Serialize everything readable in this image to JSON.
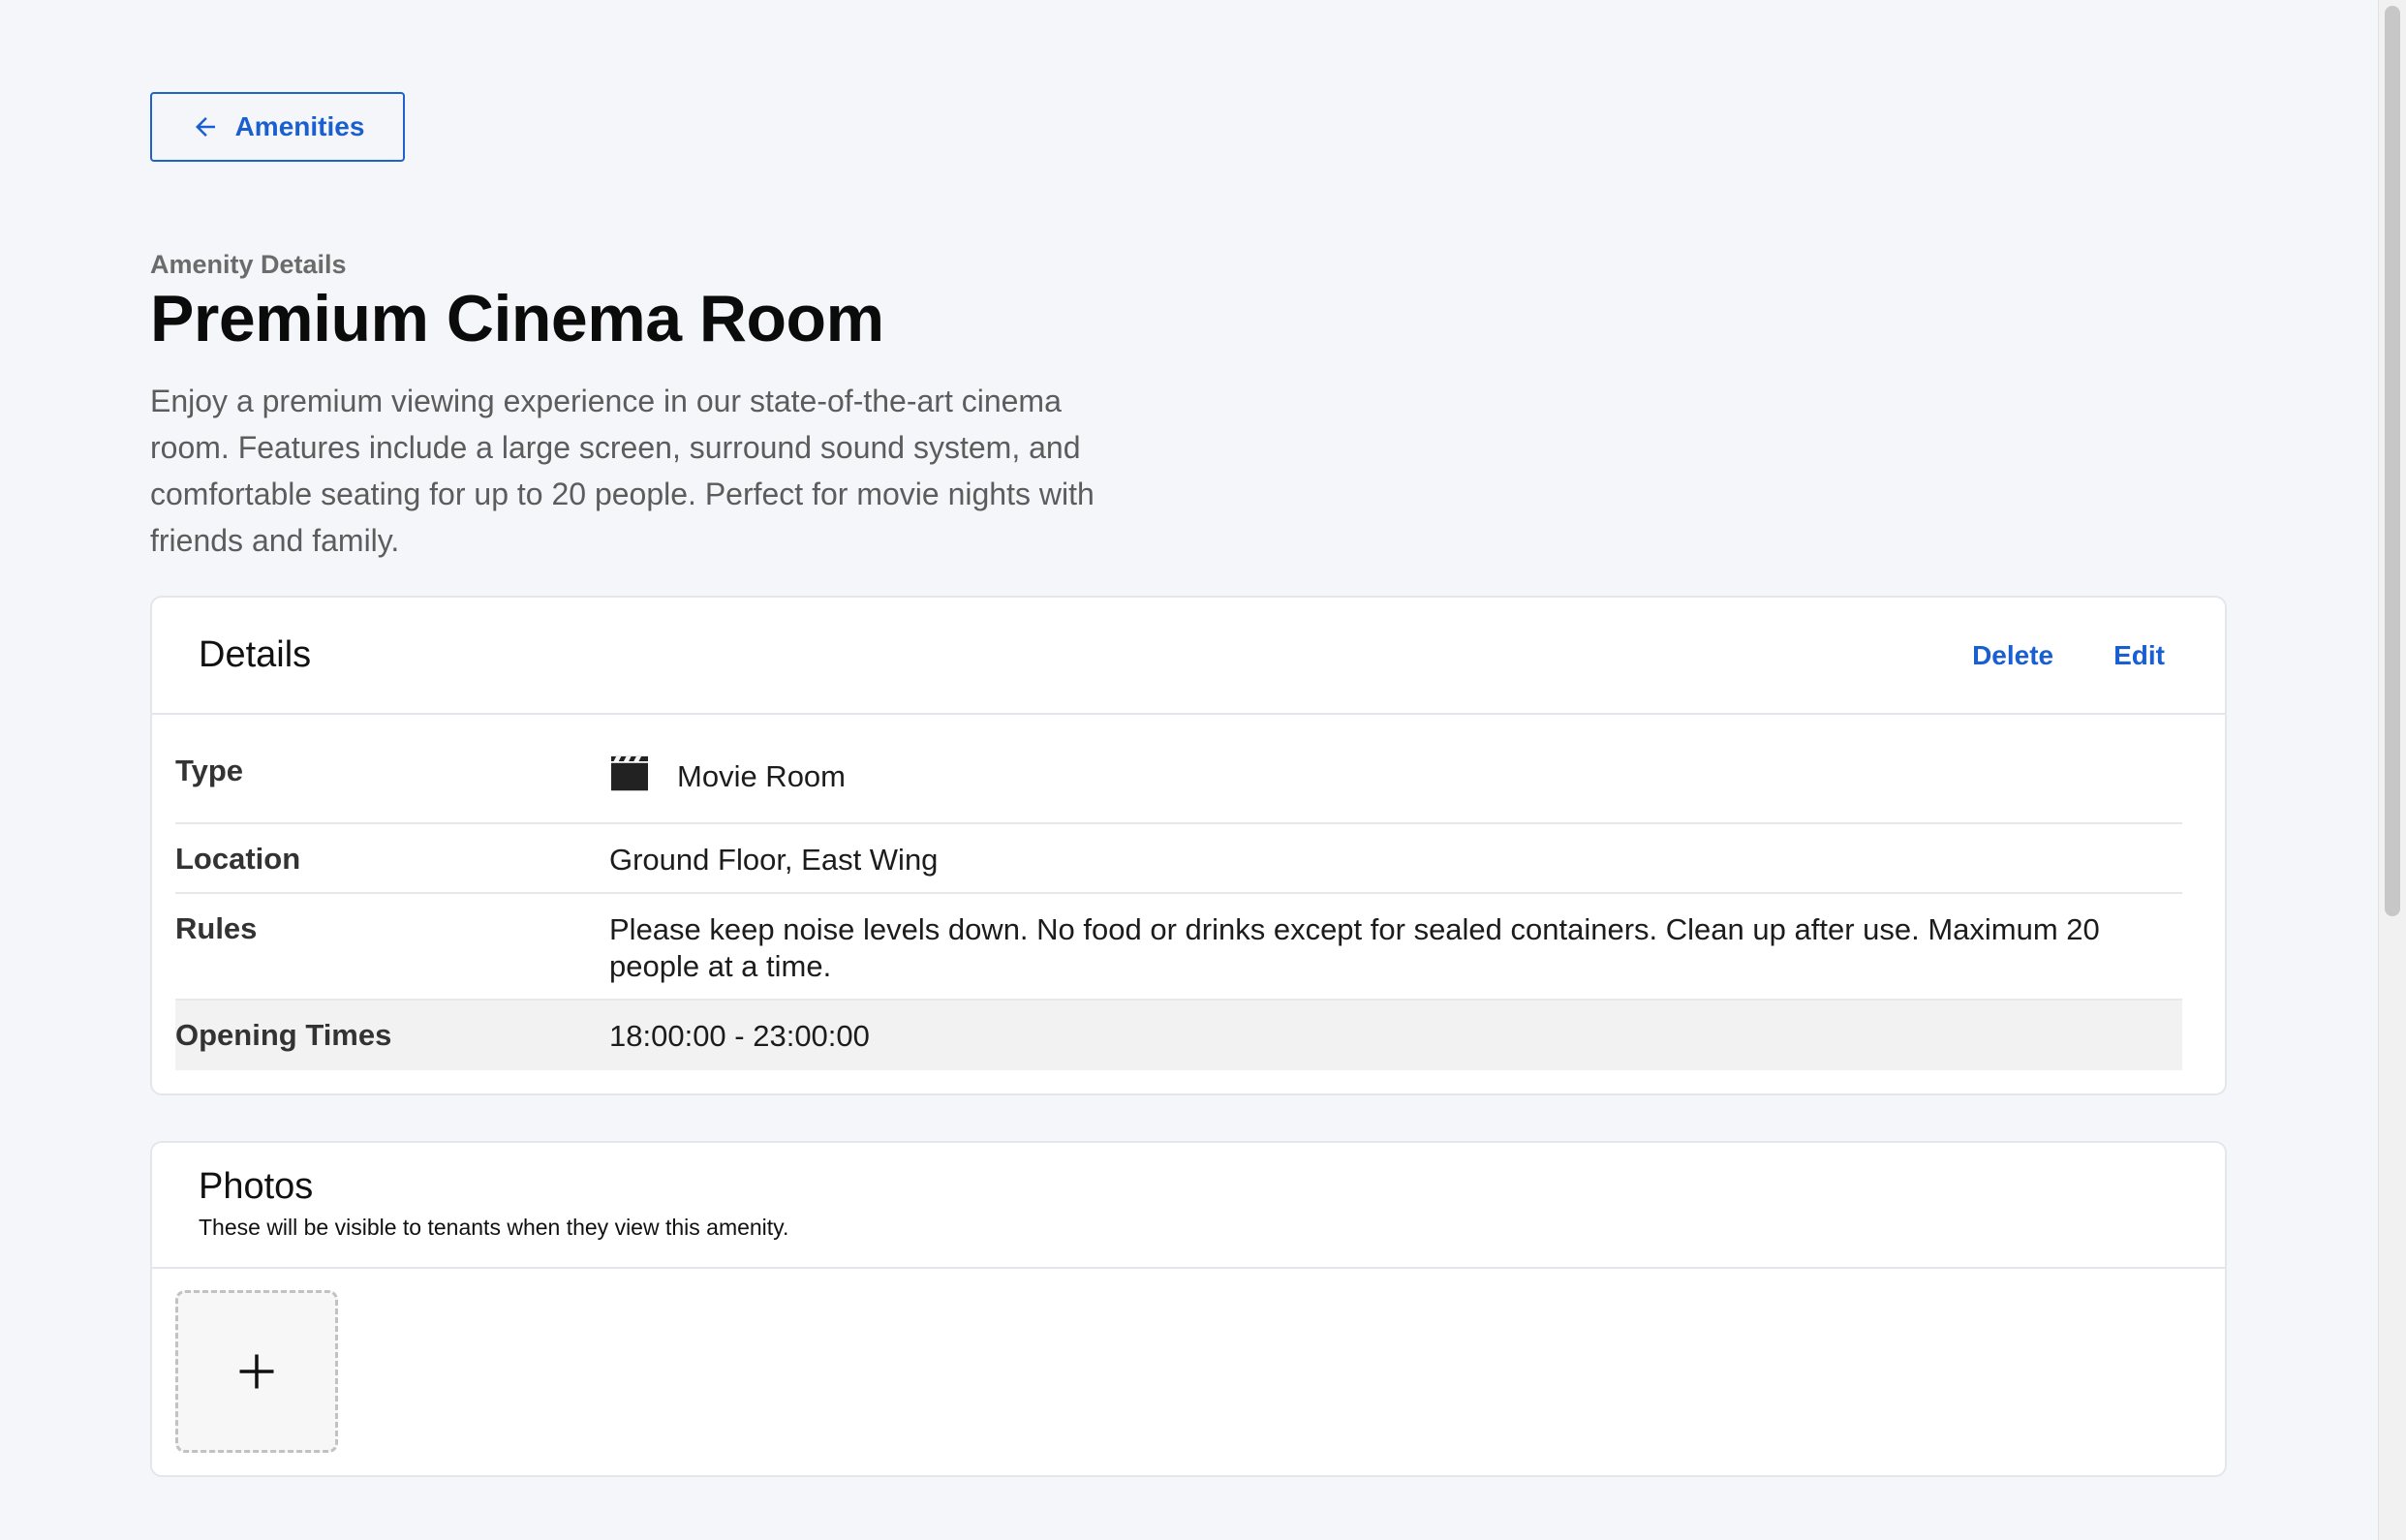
{
  "back_button": {
    "label": "Amenities",
    "icon": "arrow-left-icon"
  },
  "header": {
    "eyebrow": "Amenity Details",
    "title": "Premium Cinema Room",
    "description": "Enjoy a premium viewing experience in our state-of-the-art cinema room. Features include a large screen, surround sound system, and comfortable seating for up to 20 people. Perfect for movie nights with friends and family."
  },
  "details": {
    "title": "Details",
    "actions": {
      "delete_label": "Delete",
      "edit_label": "Edit"
    },
    "rows": [
      {
        "label": "Type",
        "value": "Movie Room",
        "icon": "clapperboard-icon"
      },
      {
        "label": "Location",
        "value": "Ground Floor, East Wing"
      },
      {
        "label": "Rules",
        "value": "Please keep noise levels down. No food or drinks except for sealed containers. Clean up after use. Maximum 20 people at a time."
      },
      {
        "label": "Opening Times",
        "value": "18:00:00 - 23:00:00"
      }
    ]
  },
  "photos": {
    "title": "Photos",
    "subtitle": "These will be visible to tenants when they view this amenity.",
    "add_icon": "plus-icon"
  },
  "colors": {
    "accent": "#1a5fd0",
    "background": "#f5f6fa",
    "card": "#ffffff",
    "highlight_row": "#f2f2f2"
  }
}
